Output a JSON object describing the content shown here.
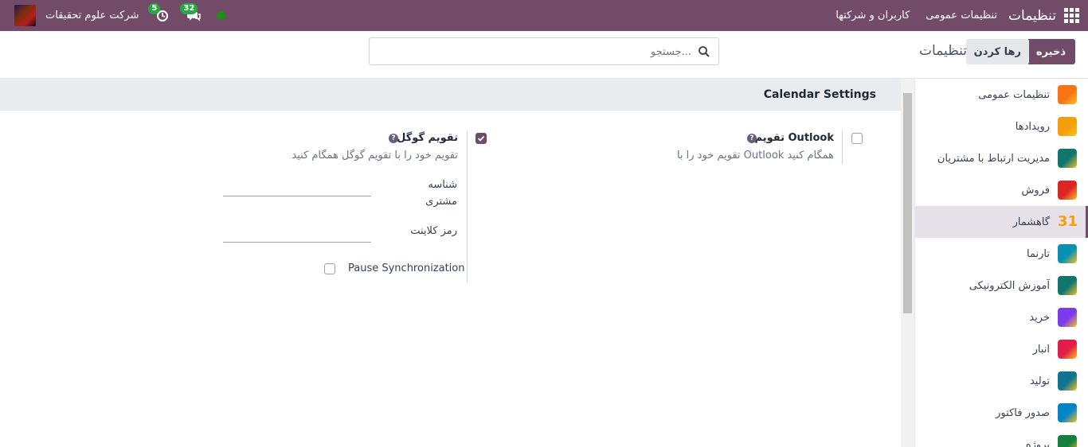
{
  "navbar": {
    "brand": "تنظیمات",
    "menu": [
      "تنظیمات عمومی",
      "کاربران و شرکتها"
    ],
    "company": "شرکت علوم تحقیقات",
    "activity_badge": "5",
    "messages_badge": "32"
  },
  "control": {
    "save_label": "ذخیره",
    "discard_label": "رها کردن",
    "title": "تنظیمات",
    "search_placeholder": "جستجو..."
  },
  "sidebar": {
    "items": [
      {
        "label": "تنظیمات عمومی",
        "color": "#f97316"
      },
      {
        "label": "رویدادها",
        "color": "#f59e0b"
      },
      {
        "label": "مدیریت ارتباط با مشتریان",
        "color": "#0f766e"
      },
      {
        "label": "فروش",
        "color": "#dc2626"
      },
      {
        "label": "گاهشمار",
        "color": "#f59e0b",
        "icon_text": "31"
      },
      {
        "label": "تارنما",
        "color": "#0891b2"
      },
      {
        "label": "آموزش الکترونیکی",
        "color": "#0f766e"
      },
      {
        "label": "خرید",
        "color": "#7c3aed"
      },
      {
        "label": "انبار",
        "color": "#e11d48"
      },
      {
        "label": "تولید",
        "color": "#0e7490"
      },
      {
        "label": "صدور فاکتور",
        "color": "#0284c7"
      },
      {
        "label": "پروژه",
        "color": "#15803d"
      }
    ],
    "active_index": 4
  },
  "section": {
    "title": "Calendar Settings"
  },
  "outlook": {
    "title": "تقویم Outlook",
    "desc": "تقویم خود را با Outlook همگام کنید",
    "checked": false
  },
  "google": {
    "title": "تقویم گوگل",
    "desc": "تقویم خود را با تقویم گوگل همگام کنید",
    "checked": true,
    "client_id_label_1": "شناسه",
    "client_id_label_2": "مشتری",
    "client_secret_label": "رمز کلاینت",
    "pause_label": "Pause Synchronization"
  },
  "colors": {
    "brand": "#714b67",
    "badge": "#28a745",
    "online": "#1a8f1a"
  }
}
